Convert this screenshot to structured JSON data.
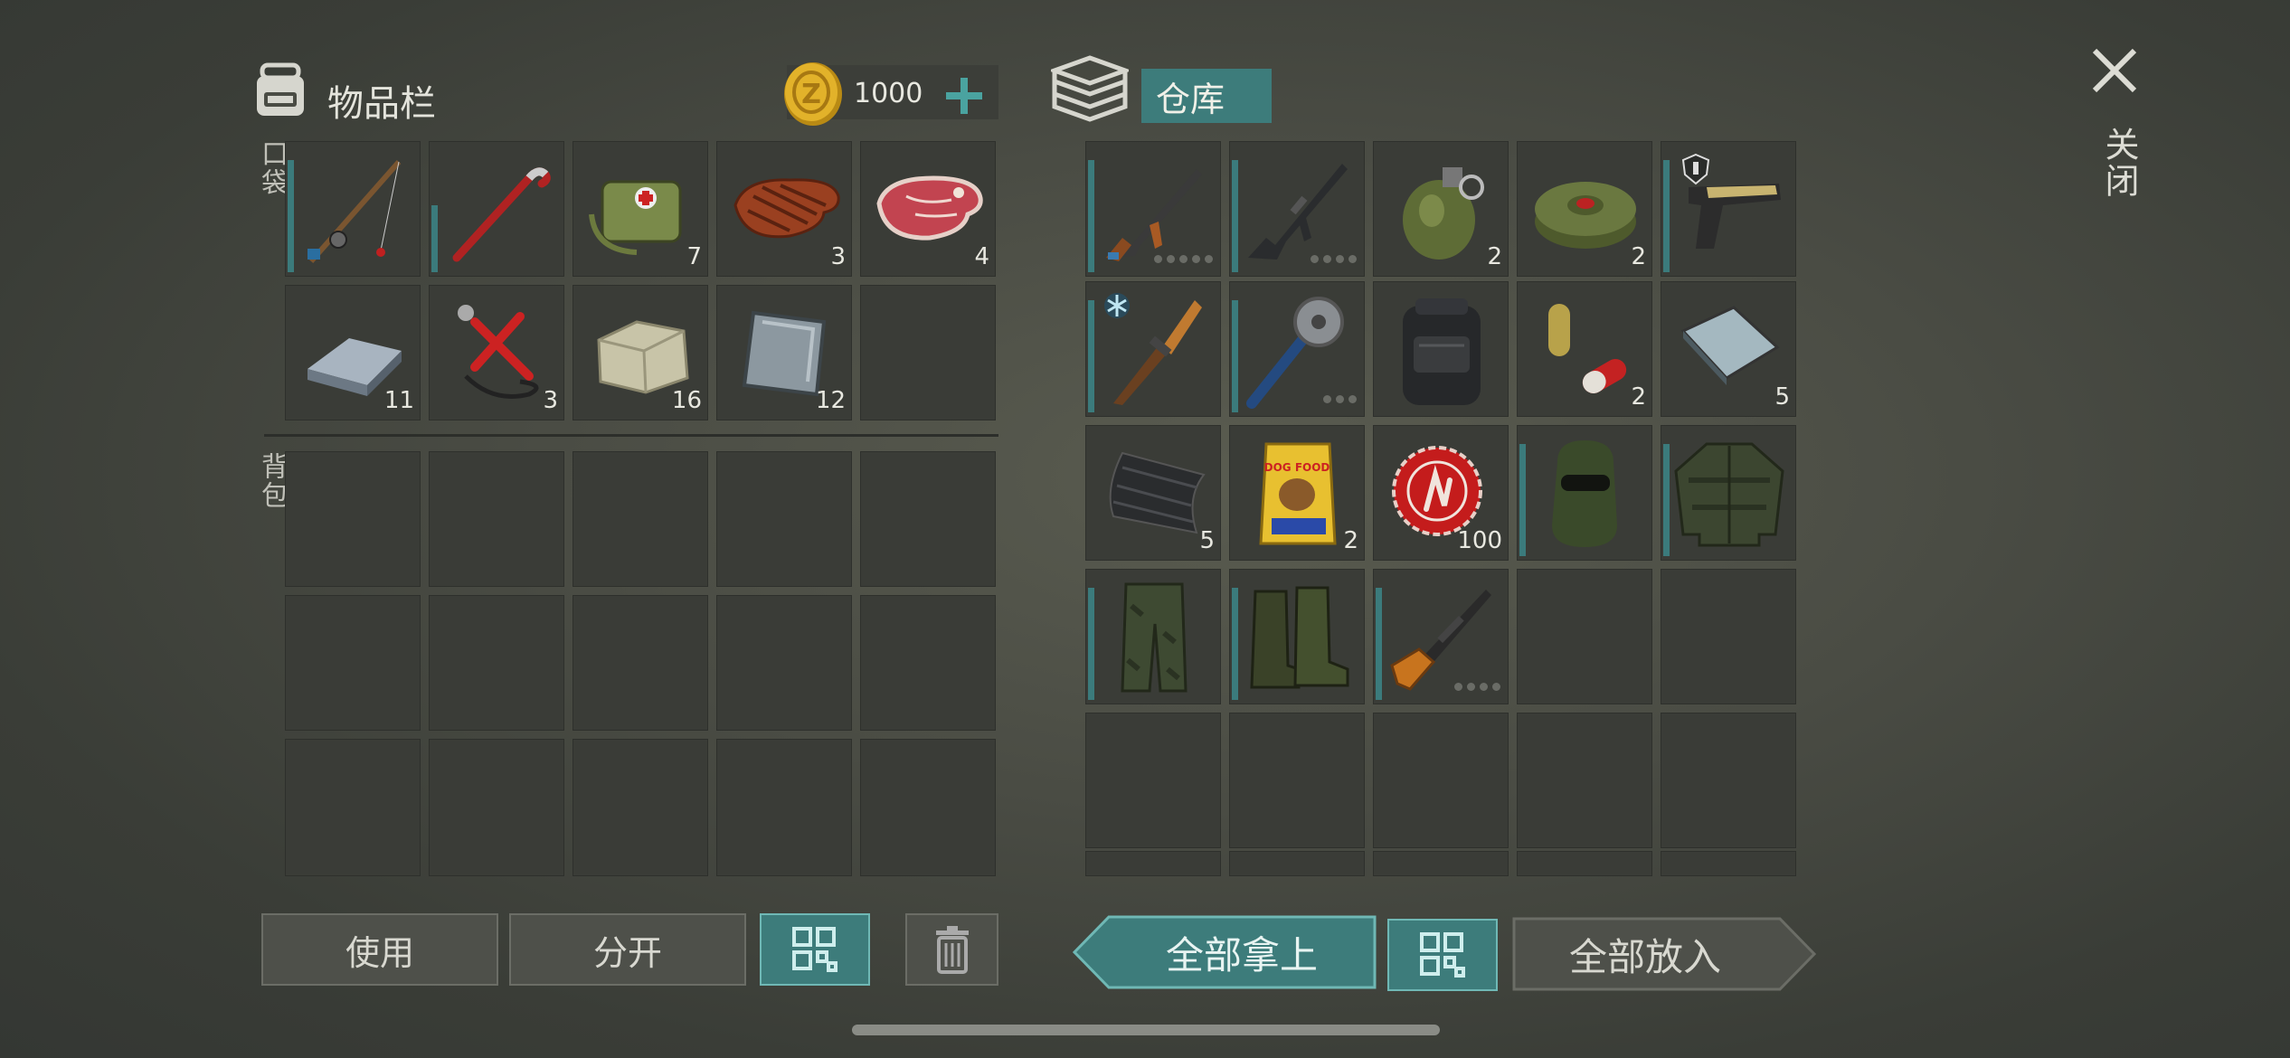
{
  "inventory": {
    "title": "物品栏",
    "coins": "1000",
    "pockets_label": "口袋",
    "backpack_label": "背包",
    "pocket_items": [
      {
        "name": "fishing-rod",
        "count": ""
      },
      {
        "name": "crowbar",
        "count": ""
      },
      {
        "name": "medical-bag",
        "count": "7"
      },
      {
        "name": "grilled-meat",
        "count": "3"
      },
      {
        "name": "raw-meat",
        "count": "4"
      },
      {
        "name": "iron-ingot",
        "count": "11"
      },
      {
        "name": "tools-kit",
        "count": "3"
      },
      {
        "name": "stone",
        "count": "16"
      },
      {
        "name": "metal-plate",
        "count": "12"
      },
      {
        "name": "empty",
        "count": ""
      }
    ]
  },
  "storage": {
    "title": "仓库",
    "items": [
      {
        "name": "ak-rifle",
        "count": ""
      },
      {
        "name": "m16-rifle",
        "count": ""
      },
      {
        "name": "grenade",
        "count": "2"
      },
      {
        "name": "landmine",
        "count": "2"
      },
      {
        "name": "pistol",
        "count": ""
      },
      {
        "name": "knife",
        "count": ""
      },
      {
        "name": "spiked-mace",
        "count": ""
      },
      {
        "name": "backpack",
        "count": ""
      },
      {
        "name": "pills",
        "count": "2"
      },
      {
        "name": "steel-sheet",
        "count": "5"
      },
      {
        "name": "carbon-fabric",
        "count": "5"
      },
      {
        "name": "dog-food",
        "count": "2"
      },
      {
        "name": "bottle-cap",
        "count": "100"
      },
      {
        "name": "balaclava",
        "count": ""
      },
      {
        "name": "ghillie-jacket",
        "count": ""
      },
      {
        "name": "camo-pants",
        "count": ""
      },
      {
        "name": "boots",
        "count": ""
      },
      {
        "name": "sniper-rifle",
        "count": ""
      }
    ],
    "dog_food_text": "DOG FOOD"
  },
  "close_label": "关闭",
  "buttons": {
    "use": "使用",
    "split": "分开",
    "take_all": "全部拿上",
    "put_all": "全部放入"
  },
  "colors": {
    "accent": "#3d7c7b",
    "slot": "#3a3c37",
    "coin": "#d9a520"
  }
}
